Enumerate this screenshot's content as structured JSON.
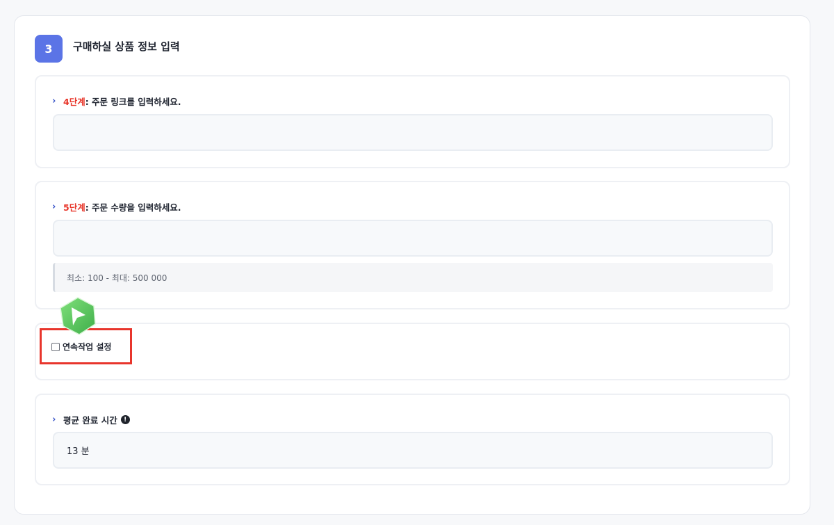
{
  "section": {
    "step_number": "3",
    "title": "구매하실 상품 정보 입력"
  },
  "link_field": {
    "step": "4단계",
    "label": ": 주문 링크를 입력하세요.",
    "value": ""
  },
  "quantity_field": {
    "step": "5단계",
    "label": ": 주문 수량을 입력하세요.",
    "value": "",
    "hint": "최소: 100 - 최대: 500 000"
  },
  "continuous": {
    "label": "연속작업 설정",
    "checked": false
  },
  "avg_time": {
    "label": "평균 완료 시간",
    "value": "13 분"
  },
  "colors": {
    "accent": "#5b74e6",
    "step_red": "#e8362a",
    "highlight": "#e8352c"
  }
}
